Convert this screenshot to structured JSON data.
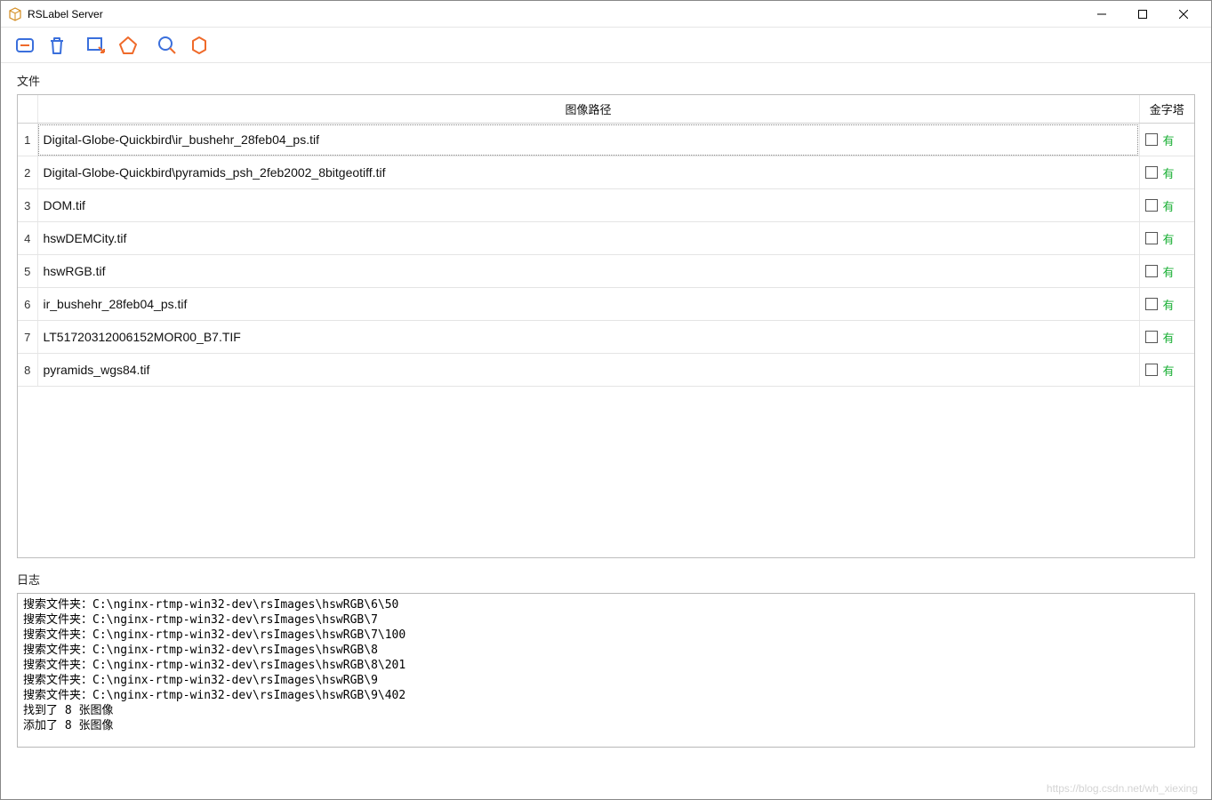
{
  "window": {
    "title": "RSLabel Server"
  },
  "sections": {
    "files_label": "文件",
    "log_label": "日志"
  },
  "table": {
    "headers": {
      "path": "图像路径",
      "pyramid": "金字塔"
    },
    "rows": [
      {
        "num": "1",
        "path": "Digital-Globe-Quickbird\\ir_bushehr_28feb04_ps.tif",
        "pyramid": "有",
        "selected": true
      },
      {
        "num": "2",
        "path": "Digital-Globe-Quickbird\\pyramids_psh_2feb2002_8bitgeotiff.tif",
        "pyramid": "有",
        "selected": false
      },
      {
        "num": "3",
        "path": "DOM.tif",
        "pyramid": "有",
        "selected": false
      },
      {
        "num": "4",
        "path": "hswDEMCity.tif",
        "pyramid": "有",
        "selected": false
      },
      {
        "num": "5",
        "path": "hswRGB.tif",
        "pyramid": "有",
        "selected": false
      },
      {
        "num": "6",
        "path": "ir_bushehr_28feb04_ps.tif",
        "pyramid": "有",
        "selected": false
      },
      {
        "num": "7",
        "path": "LT51720312006152MOR00_B7.TIF",
        "pyramid": "有",
        "selected": false
      },
      {
        "num": "8",
        "path": "pyramids_wgs84.tif",
        "pyramid": "有",
        "selected": false
      }
    ]
  },
  "log": {
    "lines": [
      "搜索文件夹：C:\\nginx-rtmp-win32-dev\\rsImages\\hswRGB\\6\\50",
      "搜索文件夹：C:\\nginx-rtmp-win32-dev\\rsImages\\hswRGB\\7",
      "搜索文件夹：C:\\nginx-rtmp-win32-dev\\rsImages\\hswRGB\\7\\100",
      "搜索文件夹：C:\\nginx-rtmp-win32-dev\\rsImages\\hswRGB\\8",
      "搜索文件夹：C:\\nginx-rtmp-win32-dev\\rsImages\\hswRGB\\8\\201",
      "搜索文件夹：C:\\nginx-rtmp-win32-dev\\rsImages\\hswRGB\\9",
      "搜索文件夹：C:\\nginx-rtmp-win32-dev\\rsImages\\hswRGB\\9\\402",
      "找到了 8 张图像",
      "添加了 8 张图像"
    ]
  },
  "watermark": "https://blog.csdn.net/wh_xiexing"
}
